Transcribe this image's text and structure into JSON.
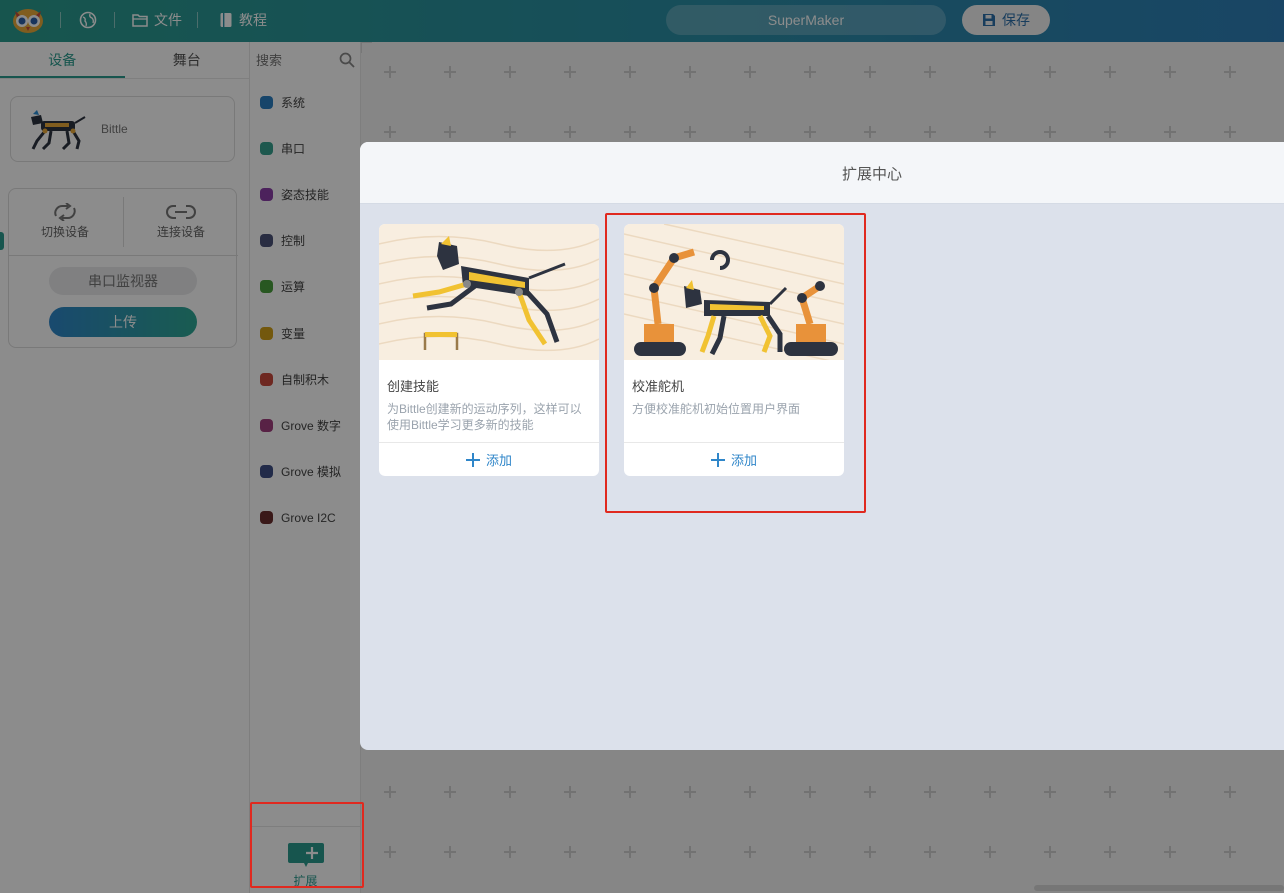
{
  "topbar": {
    "file_label": "文件",
    "tutorial_label": "教程",
    "project_name": "SuperMaker",
    "save_label": "保存"
  },
  "left_panel": {
    "tabs": [
      {
        "label": "设备",
        "active": true
      },
      {
        "label": "舞台",
        "active": false
      }
    ],
    "device_name": "Bittle",
    "switch_device": "切换设备",
    "connect_device": "连接设备",
    "serial_monitor": "串口监视器",
    "upload": "上传"
  },
  "categories": {
    "search_placeholder": "搜索",
    "items": [
      {
        "label": "系统",
        "color": "#2a7fc1"
      },
      {
        "label": "串口",
        "color": "#35a08e"
      },
      {
        "label": "姿态技能",
        "color": "#8a3fa8"
      },
      {
        "label": "控制",
        "color": "#4c5378"
      },
      {
        "label": "运算",
        "color": "#4a9e3c"
      },
      {
        "label": "变量",
        "color": "#d1a119"
      },
      {
        "label": "自制积木",
        "color": "#c94a3c"
      },
      {
        "label": "Grove 数字",
        "color": "#a13f7e"
      },
      {
        "label": "Grove 模拟",
        "color": "#3f4f86"
      },
      {
        "label": "Grove I2C",
        "color": "#6b2f2f"
      }
    ],
    "extension_label": "扩展"
  },
  "modal": {
    "title": "扩展中心",
    "cards": [
      {
        "title": "创建技能",
        "desc": "为Bittle创建新的运动序列，这样可以使用Bittle学习更多新的技能",
        "add": "添加"
      },
      {
        "title": "校准舵机",
        "desc": "方便校准舵机初始位置用户界面",
        "add": "添加"
      }
    ]
  },
  "colors": {
    "accent": "#2a9c8e",
    "link_blue": "#2f86c9",
    "highlight": "#e0291f"
  }
}
